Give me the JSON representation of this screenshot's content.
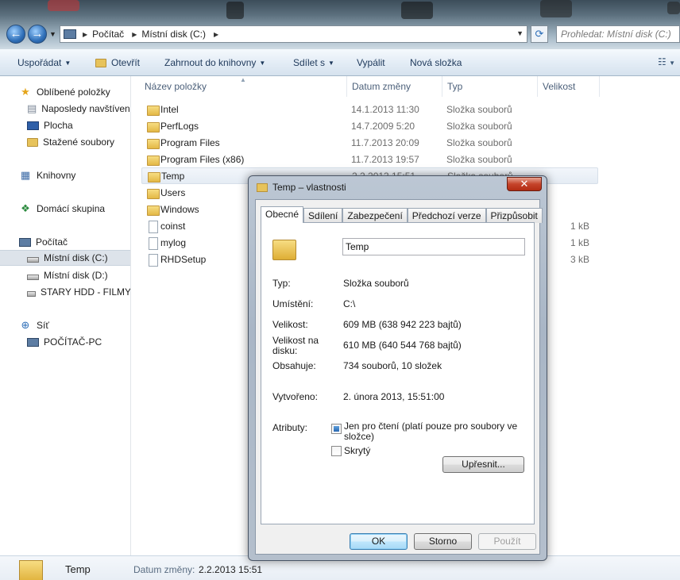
{
  "address_bar": {
    "crumbs": [
      "Počítač",
      "Místní disk (C:)"
    ],
    "search_placeholder": "Prohledat: Místní disk (C:)"
  },
  "toolbar": {
    "organize": "Uspořádat",
    "open": "Otevřít",
    "include_library": "Zahrnout do knihovny",
    "share": "Sdílet s",
    "burn": "Vypálit",
    "new_folder": "Nová složka"
  },
  "sidebar": {
    "favorites": "Oblíbené položky",
    "recent": "Naposledy navštívené",
    "desktop": "Plocha",
    "downloads": "Stažené soubory",
    "libraries": "Knihovny",
    "homegroup": "Domácí skupina",
    "computer": "Počítač",
    "drive_c": "Místní disk (C:)",
    "drive_d": "Místní disk (D:)",
    "drive_ext": "STARY HDD - FILMY",
    "network": "Síť",
    "pc_name": "POČÍTAČ-PC"
  },
  "columns": {
    "name": "Název položky",
    "date": "Datum změny",
    "type": "Typ",
    "size": "Velikost"
  },
  "files": [
    {
      "name": "Intel",
      "date": "14.1.2013 11:30",
      "type": "Složka souborů",
      "size": ""
    },
    {
      "name": "PerfLogs",
      "date": "14.7.2009 5:20",
      "type": "Složka souborů",
      "size": ""
    },
    {
      "name": "Program Files",
      "date": "11.7.2013 20:09",
      "type": "Složka souborů",
      "size": ""
    },
    {
      "name": "Program Files (x86)",
      "date": "11.7.2013 19:57",
      "type": "Složka souborů",
      "size": ""
    },
    {
      "name": "Temp",
      "date": "2.2.2013 15:51",
      "type": "Složka souborů",
      "size": ""
    },
    {
      "name": "Users",
      "date": "",
      "type": "",
      "size": ""
    },
    {
      "name": "Windows",
      "date": "",
      "type": "",
      "size": ""
    },
    {
      "name": "coinst",
      "date": "",
      "type": "",
      "size": "1 kB"
    },
    {
      "name": "mylog",
      "date": "",
      "type": "",
      "size": "1 kB"
    },
    {
      "name": "RHDSetup",
      "date": "",
      "type": "",
      "size": "3 kB"
    }
  ],
  "details_pane": {
    "name": "Temp",
    "label": "Datum změny:",
    "value": "2.2.2013 15:51"
  },
  "dialog": {
    "title": "Temp – vlastnosti",
    "close": "✕",
    "tabs": [
      "Obecné",
      "Sdílení",
      "Zabezpečení",
      "Předchozí verze",
      "Přizpůsobit"
    ],
    "name_value": "Temp",
    "type_label": "Typ:",
    "type_value": "Složka souborů",
    "location_label": "Umístění:",
    "location_value": "C:\\",
    "size_label": "Velikost:",
    "size_value": "609 MB (638 942 223 bajtů)",
    "disk_size_label_1": "Velikost na",
    "disk_size_label_2": "disku:",
    "disk_size_value": "610 MB (640 544 768 bajtů)",
    "contains_label": "Obsahuje:",
    "contains_value": "734 souborů, 10 složek",
    "created_label": "Vytvořeno:",
    "created_value": "2. února 2013, 15:51:00",
    "attributes_label": "Atributy:",
    "readonly_label": "Jen pro čtení (platí pouze pro soubory ve složce)",
    "hidden_label": "Skrytý",
    "advanced_button": "Upřesnit...",
    "ok": "OK",
    "cancel": "Storno",
    "apply": "Použít"
  }
}
